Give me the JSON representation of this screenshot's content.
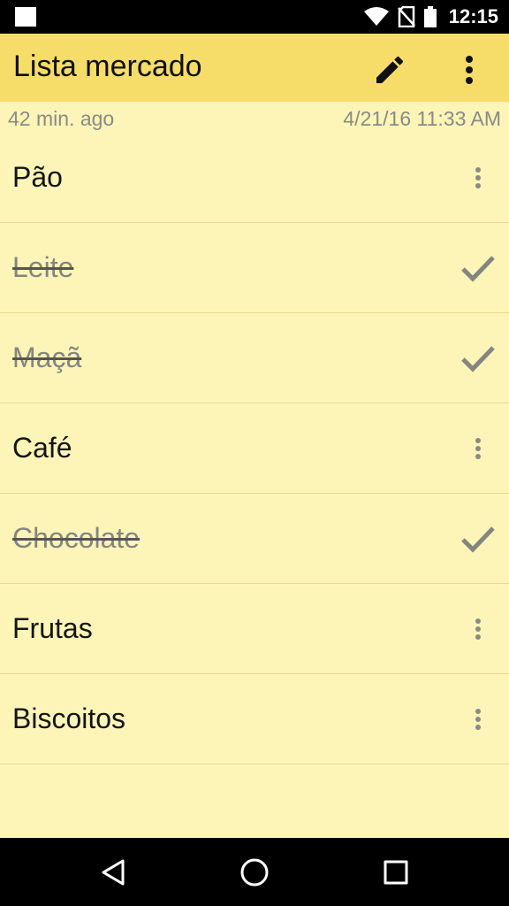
{
  "status_bar": {
    "time": "12:15",
    "icons": [
      "notification-icon",
      "wifi-icon",
      "no-sim-icon",
      "battery-icon"
    ]
  },
  "app_bar": {
    "title": "Lista mercado",
    "actions": [
      "edit-pencil-icon",
      "more-vert-icon"
    ]
  },
  "meta": {
    "age": "42 min. ago",
    "date": "4/21/16 11:33 AM"
  },
  "items": [
    {
      "label": "Pão",
      "done": false
    },
    {
      "label": "Leite",
      "done": true
    },
    {
      "label": "Maçã",
      "done": true
    },
    {
      "label": "Café",
      "done": false
    },
    {
      "label": "Chocolate",
      "done": true
    },
    {
      "label": "Frutas",
      "done": false
    },
    {
      "label": "Biscoitos",
      "done": false
    }
  ],
  "nav_bar": {
    "buttons": [
      "back-icon",
      "home-icon",
      "recents-icon"
    ]
  },
  "colors": {
    "app_bar": "#f6dc69",
    "background": "#fdf5b8",
    "divider": "#ebd98a",
    "muted_text": "#858580"
  }
}
